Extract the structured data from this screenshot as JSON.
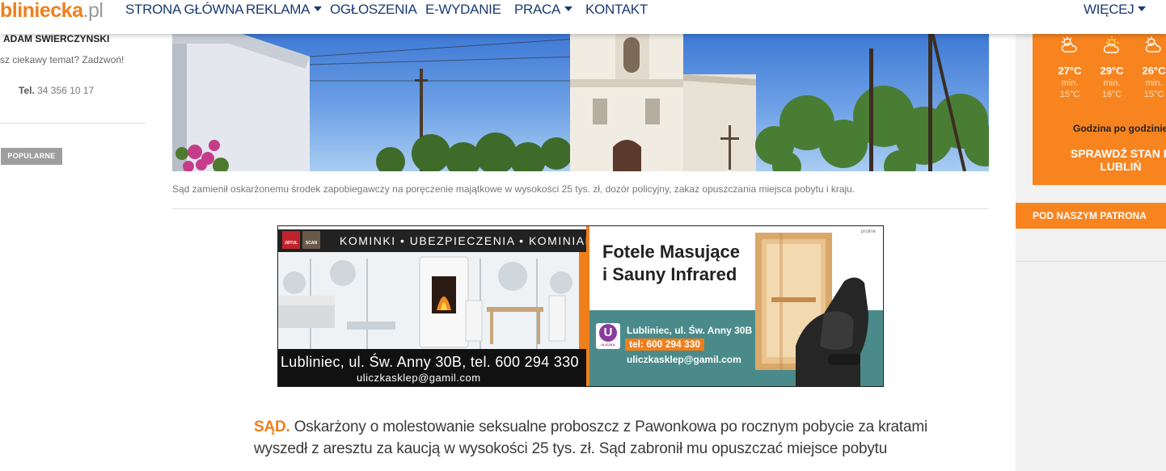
{
  "nav": {
    "logo_brand": "bliniecka",
    "logo_tld": ".pl",
    "items": [
      "STRONA GŁÓWNA",
      "REKLAMA",
      "OGŁOSZENIA",
      "E-WYDANIE",
      "PRACA",
      "KONTAKT"
    ],
    "more": "WIĘCEJ"
  },
  "sidebar": {
    "author": "ADAM SWIERCZYNSKI",
    "prompt": "sz ciekawy temat? Zadzwoń!",
    "tel_label": "Tel.",
    "tel_value": "34 356 10 17",
    "popular": "POPULARNE"
  },
  "article": {
    "caption": "Sąd zamienił oskarżonemu środek zapobiegawczy na poręczenie majątkowe w wysokości 25 tys. zł, dozór policyjny, zakaz opuszczania miejsca pobytu i kraju.",
    "lead_kicker": "SĄD.",
    "lead_text": "Oskarżony o molestowanie seksualne proboszcz z Pawonkowa po rocznym pobycie za kratami wyszedł z aresztu za kaucją w wysokości 25 tys. zł. Sąd zabronił mu opuszczać miejsce pobytu"
  },
  "ad": {
    "tagline": "KOMINKI • UBEZPIECZENIA • KOMINIARZ",
    "brand_1": "JØTUL",
    "brand_2": "SCAN",
    "address_left": "Lubliniec, ul. Św. Anny 30B, tel. 600 294 330",
    "email_left": "uliczkasklep@gamil.com",
    "headline_1": "Fotele Masujące",
    "headline_2": "i Sauny Infrared",
    "logo_letter": "U",
    "logo_name": "ULICZKA",
    "address_right": "Lubliniec, ul. Św. Anny 30B",
    "phone_right": "tel: 600 294 330",
    "email_right": "uliczkasklep@gamil.com",
    "partner": "proline"
  },
  "weather": {
    "days": [
      {
        "temp": "27°C",
        "min_label": "min.",
        "min": "15°C"
      },
      {
        "temp": "29°C",
        "min_label": "min.",
        "min": "16°C"
      },
      {
        "temp": "26°C",
        "min_label": "min.",
        "min": "15°C"
      }
    ],
    "hourly": "Godzina po godzinie",
    "check": "SPRAWDŹ STAN P LUBLIŃ"
  },
  "patronage": "POD NASZYM PATRONA"
}
